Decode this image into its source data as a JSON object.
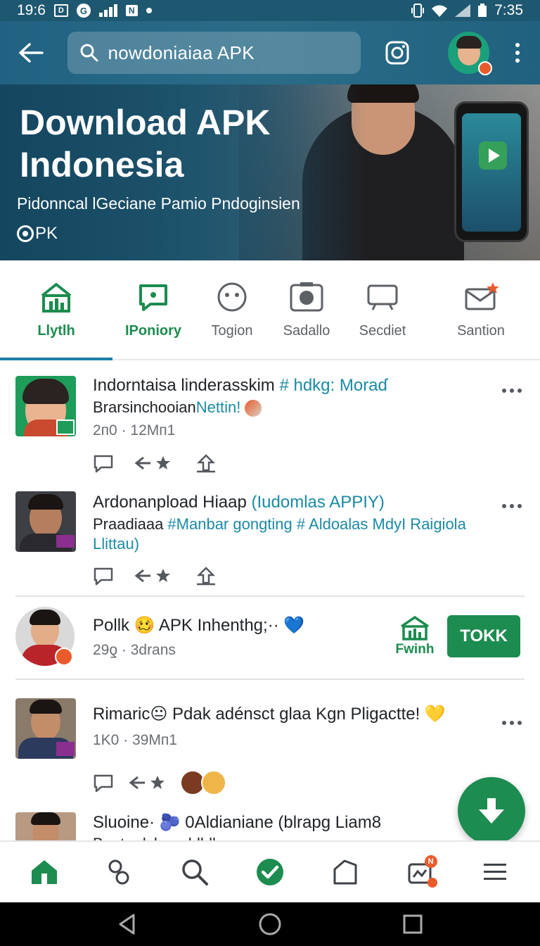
{
  "status_bar": {
    "time_left": "19:6",
    "time_right": "7:35",
    "g_icon": "G",
    "n_label": "N"
  },
  "app_bar": {
    "search_value": "nowdoniaiaa APK",
    "icons": [
      "back-arrow-icon",
      "search-icon",
      "instagram-icon",
      "profile-avatar",
      "more-vert-icon"
    ]
  },
  "hero": {
    "title": "Download APK Indonesia",
    "subtitle": "Pidonncal lGeciane Pamio Pndoginsien",
    "brand": "PK"
  },
  "categories": [
    {
      "label": "Llytlh",
      "icon": "house-chart-icon",
      "active": true
    },
    {
      "label": "IPoniory",
      "icon": "chat-bubble-icon",
      "active": false
    },
    {
      "label": "Togion",
      "icon": "smiley-icon",
      "active": false
    },
    {
      "label": "Sadallo",
      "icon": "camera-icon",
      "active": false
    },
    {
      "label": "Secdiet",
      "icon": "monitor-icon",
      "active": false
    },
    {
      "label": "Santion",
      "icon": "mail-star-icon",
      "active": false
    }
  ],
  "posts": [
    {
      "title_main": "Indorntaisa linderasskim ",
      "title_hash": "# hdkg: Moraɗ",
      "line2_main": "Brarsinchooian",
      "line2_hash": "Nettin!",
      "meta": "2п0 · 12Mп1"
    },
    {
      "title_main": "Ardonanpload Hiaap ",
      "title_hash": "(Iudomlas APPIY)",
      "line2_main": "Praadiaaa ",
      "line2_hash": "#Manbar gongting # Aldoalas MdyI Raigiola",
      "line3": "Llittau)",
      "meta": ""
    },
    {
      "title": "Pollk 🥴 APK Inhenthg;·· 💙",
      "meta": "29ƍ · 3drans",
      "side_label": "Fwinh",
      "button": "TOKK"
    },
    {
      "title": "Rimaric😐 Pdak adénsct glaa Kgn Pligactte! 💛",
      "meta": "1K0 · 39Mп1"
    },
    {
      "title": "Sluoine· 🫐 0Aldianiane (blrapg Liam8",
      "line2": "Buntru lshanoldhlle"
    }
  ],
  "bottom_nav": {
    "items": [
      "home-icon",
      "link-icon",
      "search-icon",
      "check-circle-icon",
      "tag-icon",
      "card-notify-icon",
      "menu-icon"
    ],
    "badge": "N"
  },
  "colors": {
    "primary": "#216282",
    "accent_green": "#1d8c50",
    "hashtag": "#1b8aa5",
    "badge": "#ea5b2c"
  }
}
